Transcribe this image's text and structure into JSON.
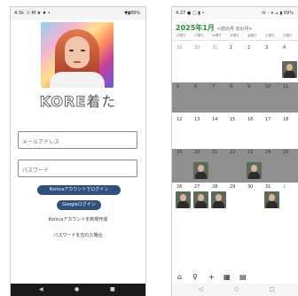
{
  "left_screen": {
    "status": {
      "time": "4:3x",
      "icons": "⊂ M ★ ♦ •",
      "right": "▼▮89%"
    },
    "brand": {
      "logo_prefix": "KORE",
      "logo_suffix": "着た"
    },
    "form": {
      "email_placeholder": "メールアドレス",
      "password_placeholder": "パスワード"
    },
    "buttons": {
      "konica_login": "Konicaアカウントでログイン",
      "google_login": "Googleログイン"
    },
    "links": {
      "register": "Konicaアカウントを新規作成",
      "forgot": "パスワードを忘れた場合"
    },
    "navbar": {
      "back": "◀",
      "home": "●",
      "recent": "■"
    }
  },
  "right_screen": {
    "status": {
      "time": "4:27 ● ▢ ▮ •",
      "right": "✉ ◦ ▾ ⊿ ▮ 69%"
    },
    "calendar": {
      "title": "2025年1月",
      "nav": "<前の月  次の月>",
      "weekdays": [
        "月曜日",
        "火曜日",
        "水曜日",
        "木曜日",
        "金曜日",
        "土曜日",
        "日曜日"
      ],
      "weeks": [
        [
          "29",
          "30",
          "31",
          "1",
          "2",
          "3",
          "4"
        ],
        [
          "5",
          "6",
          "7",
          "8",
          "9",
          "10",
          "11"
        ],
        [
          "12",
          "13",
          "14",
          "15",
          "16",
          "17",
          "18"
        ],
        [
          "19",
          "20",
          "21",
          "22",
          "23",
          "24",
          "25"
        ],
        [
          "26",
          "27",
          "28",
          "29",
          "30",
          "31",
          "1"
        ]
      ]
    },
    "toolbar": {
      "home_icon": "⌂",
      "search_icon": "⚲",
      "add_icon": "+",
      "calendar_icon": "▦",
      "calendar2_icon": "▤"
    },
    "navbar": {
      "back": "◁",
      "home": "○",
      "recent": "□"
    }
  },
  "colors": {
    "primary_button": "#2f4f7c",
    "calendar_title": "#2f8a40",
    "gray_row": "#8f8f8f"
  }
}
